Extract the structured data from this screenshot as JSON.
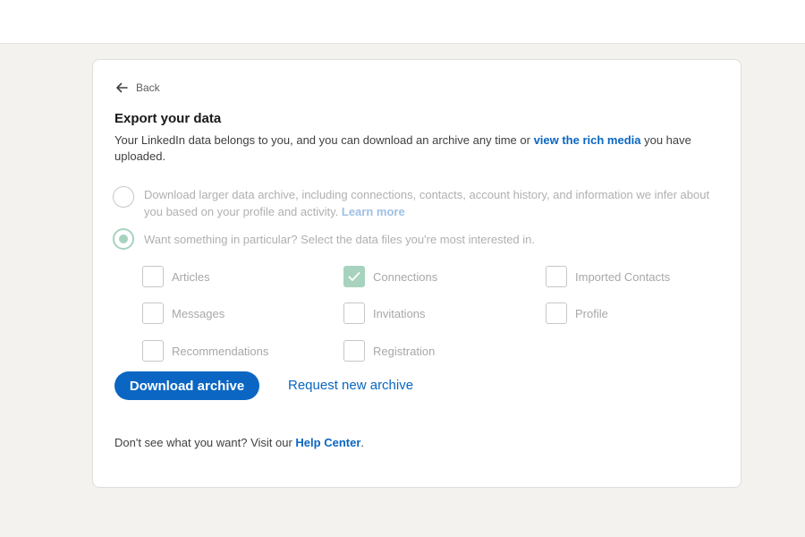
{
  "back": {
    "label": "Back"
  },
  "page": {
    "title": "Export your data",
    "desc_before": "Your LinkedIn data belongs to you, and you can download an archive any time or ",
    "desc_link": "view the rich media",
    "desc_after": " you have uploaded."
  },
  "options": {
    "full": {
      "text": "Download larger data archive, including connections, contacts, account history, and information we infer about you based on your profile and activity. ",
      "learn_more": "Learn more",
      "selected": false
    },
    "particular": {
      "text": "Want something in particular? Select the data files you're most interested in.",
      "selected": true
    }
  },
  "checkboxes": [
    {
      "label": "Articles",
      "checked": false
    },
    {
      "label": "Connections",
      "checked": true
    },
    {
      "label": "Imported Contacts",
      "checked": false
    },
    {
      "label": "Messages",
      "checked": false
    },
    {
      "label": "Invitations",
      "checked": false
    },
    {
      "label": "Profile",
      "checked": false
    },
    {
      "label": "Recommendations",
      "checked": false
    },
    {
      "label": "Registration",
      "checked": false
    }
  ],
  "actions": {
    "download": "Download archive",
    "request": "Request new archive"
  },
  "footer": {
    "text": "Don't see what you want? Visit our ",
    "link": "Help Center",
    "end": "."
  },
  "colors": {
    "brand": "#0a66c2",
    "selected_disabled": "#a7d3be",
    "background": "#f3f2ef"
  },
  "icons": {
    "back": "arrow-left-icon",
    "check": "checkmark-icon"
  }
}
